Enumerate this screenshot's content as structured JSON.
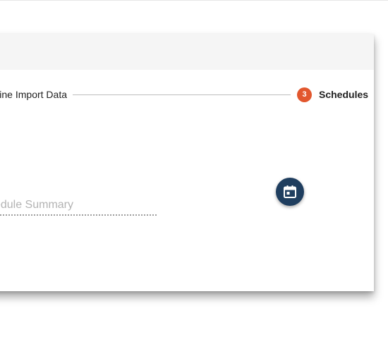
{
  "stepper": {
    "previous_step_label": "Define Import Data",
    "current_step_number": "3",
    "current_step_label": "Schedules"
  },
  "summary": {
    "placeholder": "Schedule Summary"
  },
  "colors": {
    "step_active": "#e2572e",
    "fab_background": "#1f3e5f",
    "header_background": "#f5f5f5"
  },
  "icons": {
    "fab_icon": "calendar-icon"
  }
}
